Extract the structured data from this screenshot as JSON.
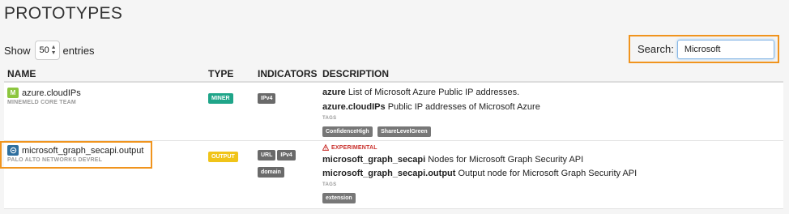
{
  "page": {
    "title": "PROTOTYPES"
  },
  "length_menu": {
    "show_label": "Show",
    "value": "50",
    "entries_label": "entries"
  },
  "search": {
    "label": "Search:",
    "value": "Microsoft"
  },
  "table": {
    "headers": {
      "name": "NAME",
      "type": "TYPE",
      "indicators": "INDICATORS",
      "description": "DESCRIPTION"
    },
    "rows": [
      {
        "name": "azure.cloudIPs",
        "icon": "miner-icon",
        "author": "MINEMELD CORE TEAM",
        "type": "MINER",
        "type_color": "#1fa589",
        "indicators": [
          "IPv4"
        ],
        "experimental": "",
        "desc": [
          {
            "key": "azure",
            "text": "List of Microsoft Azure Public IP addresses."
          },
          {
            "key": "azure.cloudIPs",
            "text": "Public IP addresses of Microsoft Azure"
          }
        ],
        "tags_label": "TAGS",
        "tags": [
          "ConfidenceHigh",
          "ShareLevelGreen"
        ]
      },
      {
        "name": "microsoft_graph_secapi.output",
        "icon": "output-node-icon",
        "author": "PALO ALTO NETWORKS DEVREL",
        "type": "OUTPUT",
        "type_color": "#f0c419",
        "indicators": [
          "URL",
          "IPv4",
          "domain"
        ],
        "experimental": "EXPERIMENTAL",
        "desc": [
          {
            "key": "microsoft_graph_secapi",
            "text": "Nodes for Microsoft Graph Security API"
          },
          {
            "key": "microsoft_graph_secapi.output",
            "text": "Output node for Microsoft Graph Security API"
          }
        ],
        "tags_label": "TAGS",
        "tags": [
          "extension"
        ]
      }
    ]
  },
  "colors": {
    "highlight": "#f0941e",
    "indicator_badge": "#6a6a6a",
    "tag_badge": "#777777",
    "experimental": "#c9302c"
  }
}
